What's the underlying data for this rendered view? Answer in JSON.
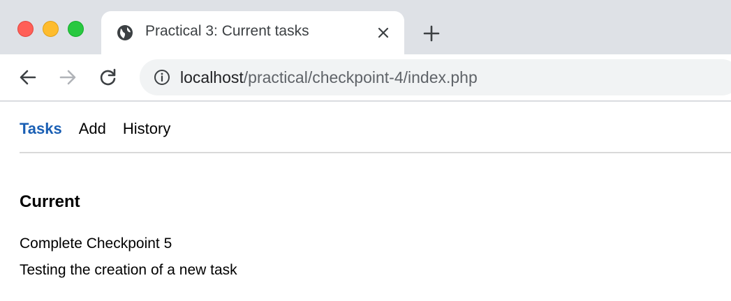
{
  "browser": {
    "tab": {
      "title": "Practical 3: Current tasks"
    },
    "address": {
      "host": "localhost",
      "path": "/practical/checkpoint-4/index.php"
    }
  },
  "page": {
    "nav": [
      {
        "label": "Tasks",
        "active": true
      },
      {
        "label": "Add",
        "active": false
      },
      {
        "label": "History",
        "active": false
      }
    ],
    "heading": "Current",
    "tasks": [
      "Complete Checkpoint 5",
      "Testing the creation of a new task"
    ]
  },
  "colors": {
    "active_link": "#1a5fb4",
    "tab_strip": "#dee1e6",
    "omnibox": "#f1f3f4"
  },
  "icons": [
    "globe-icon",
    "close-icon",
    "plus-icon",
    "back-arrow-icon",
    "forward-arrow-icon",
    "reload-icon",
    "info-icon"
  ]
}
